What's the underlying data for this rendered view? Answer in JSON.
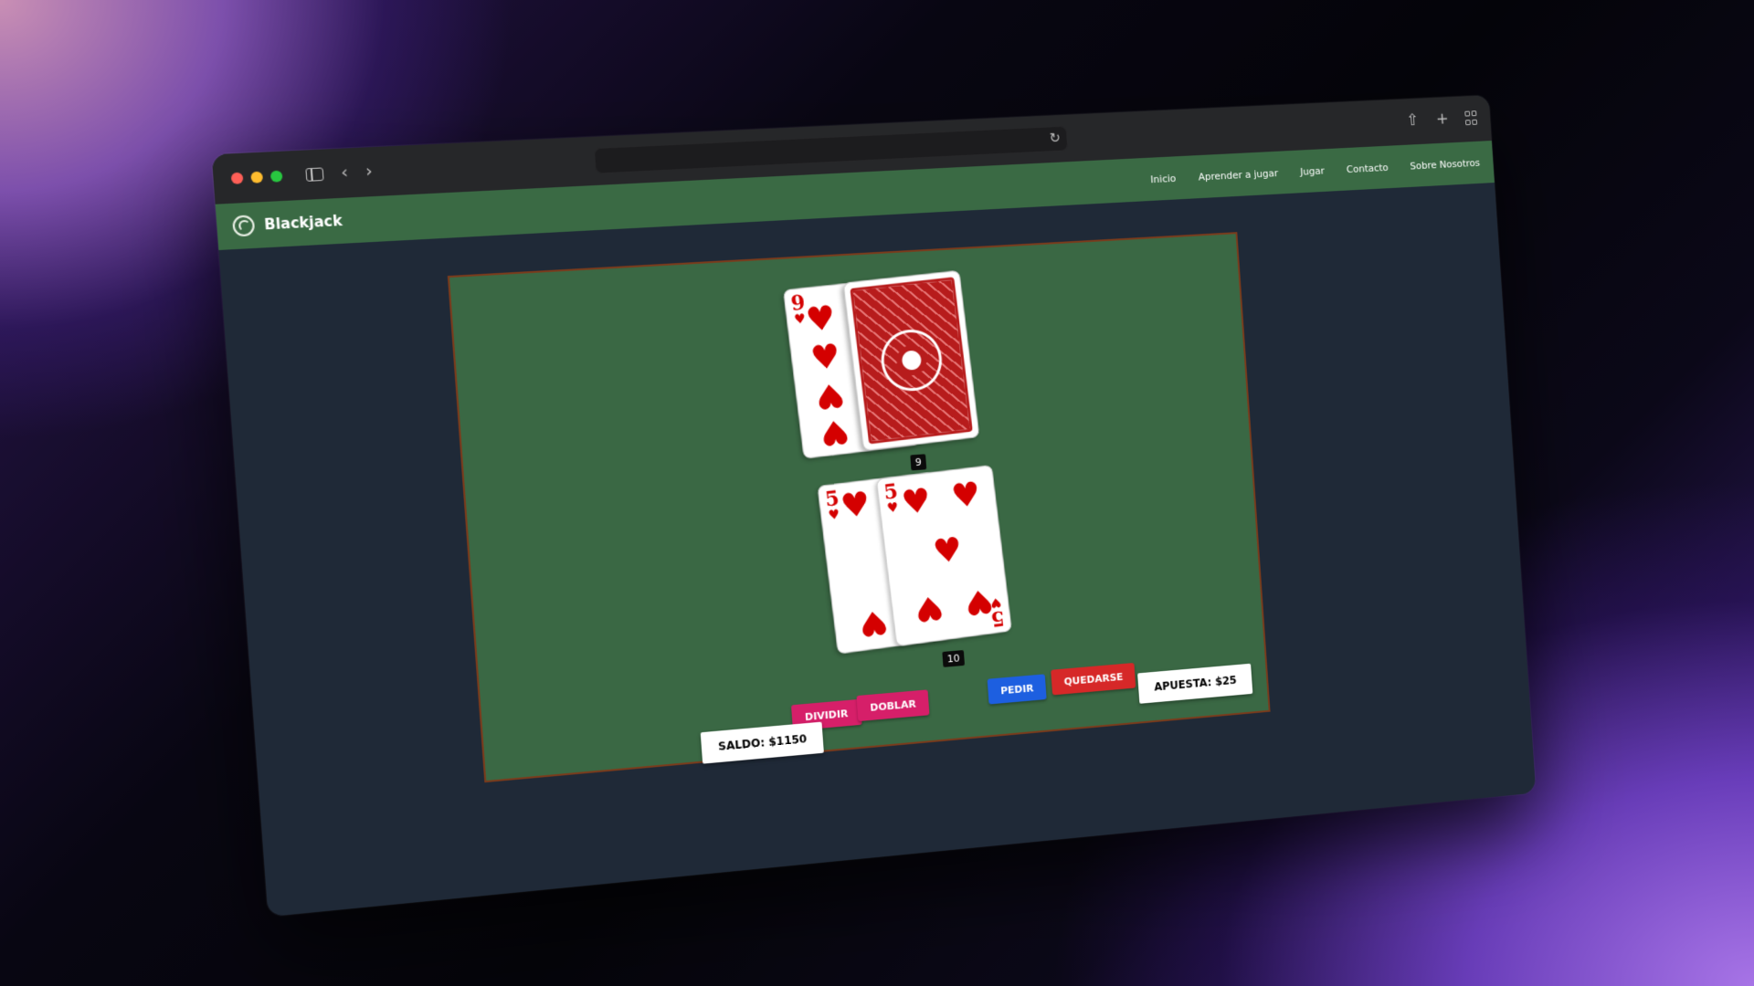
{
  "browser": {
    "url": "",
    "reload_icon": "reload-icon",
    "share_icon": "share-icon",
    "new_tab_icon": "plus-icon",
    "tabs_icon": "tab-overview-icon"
  },
  "navbar": {
    "brand": "Blackjack",
    "links": [
      "Inicio",
      "Aprender a jugar",
      "Jugar",
      "Contacto",
      "Sobre Nosotros"
    ]
  },
  "dealer": {
    "cards": [
      {
        "rank": "9",
        "suit": "♥",
        "face": "up"
      },
      {
        "face": "down"
      }
    ],
    "score": "9"
  },
  "player": {
    "cards": [
      {
        "rank": "5",
        "suit": "♥",
        "face": "up"
      },
      {
        "rank": "5",
        "suit": "♥",
        "face": "up"
      }
    ],
    "score": "10"
  },
  "actions": {
    "split": "DIVIDIR",
    "double": "DOBLAR",
    "hit": "PEDIR",
    "stand": "QUEDARSE"
  },
  "balance": "SALDO: $1150",
  "bet": "APUESTA: $25",
  "colors": {
    "navbar": "#3a6a44",
    "table": "#3a6844",
    "table_border": "#7a3b1c",
    "page_bg": "#1f2937",
    "btn_pink": "#d61f69",
    "btn_blue": "#1d5fe0",
    "btn_red": "#d62828",
    "card_red": "#d40000"
  }
}
